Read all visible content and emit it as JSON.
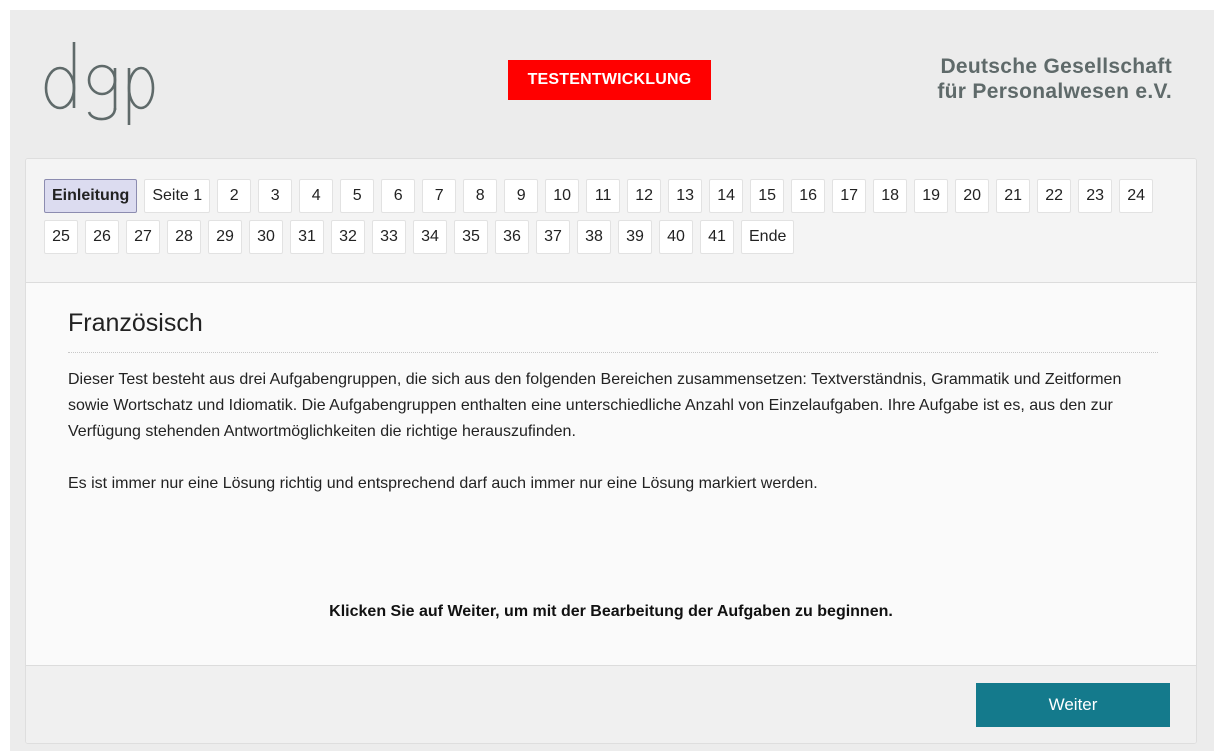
{
  "header": {
    "logo_text": "dgp",
    "badge": "TESTENTWICKLUNG",
    "org_line1": "Deutsche Gesellschaft",
    "org_line2": "für Personalwesen e.V."
  },
  "nav": {
    "active": "Einleitung",
    "items": [
      "Einleitung",
      "Seite 1",
      "2",
      "3",
      "4",
      "5",
      "6",
      "7",
      "8",
      "9",
      "10",
      "11",
      "12",
      "13",
      "14",
      "15",
      "16",
      "17",
      "18",
      "19",
      "20",
      "21",
      "22",
      "23",
      "24",
      "25",
      "26",
      "27",
      "28",
      "29",
      "30",
      "31",
      "32",
      "33",
      "34",
      "35",
      "36",
      "37",
      "38",
      "39",
      "40",
      "41",
      "Ende"
    ]
  },
  "content": {
    "title": "Französisch",
    "paragraph1": "Dieser Test besteht aus drei Aufgabengruppen, die sich aus den folgenden Bereichen zusammensetzen: Textverständnis, Grammatik und Zeitformen sowie Wortschatz und Idiomatik. Die Aufgabengruppen enthalten eine unterschiedliche Anzahl von Einzelaufgaben. Ihre Aufgabe ist es, aus den zur Verfügung stehenden Antwortmöglichkeiten die richtige herauszufinden.",
    "paragraph2": "Es ist immer nur eine Lösung richtig und entsprechend darf auch immer nur eine Lösung markiert werden.",
    "cta": "Klicken Sie auf Weiter, um mit der Bearbeitung der Aufgaben zu beginnen."
  },
  "footer": {
    "next_label": "Weiter"
  },
  "colors": {
    "badge": "#ff0000",
    "next_button": "#147a8c",
    "active_nav": "#dcdcf0",
    "org_text": "#5f6a6a"
  }
}
